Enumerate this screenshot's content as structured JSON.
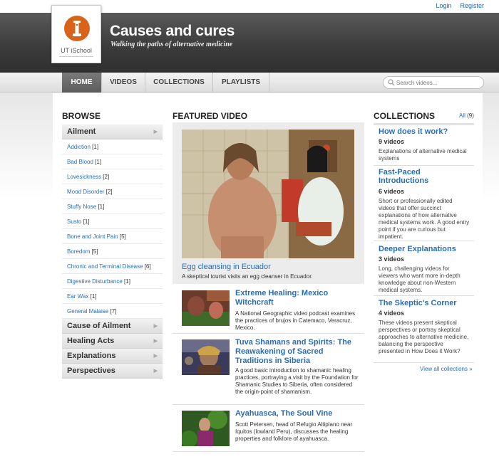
{
  "top_links": {
    "login": "Login",
    "register": "Register"
  },
  "header": {
    "logo_text": "UT iSchool",
    "title": "Causes and cures",
    "tagline": "Walking the paths of alternative medicine",
    "brand_color": "#d8641c"
  },
  "nav": {
    "items": [
      {
        "label": "HOME",
        "active": true
      },
      {
        "label": "VIDEOS",
        "active": false
      },
      {
        "label": "COLLECTIONS",
        "active": false
      },
      {
        "label": "PLAYLISTS",
        "active": false
      }
    ],
    "search_placeholder": "Search videos..."
  },
  "browse": {
    "heading": "BROWSE",
    "categories": [
      {
        "label": "Ailment",
        "expanded": true
      },
      {
        "label": "Cause of Ailment"
      },
      {
        "label": "Healing Acts"
      },
      {
        "label": "Explanations"
      },
      {
        "label": "Perspectives"
      }
    ],
    "ailments": [
      {
        "label": "Addiction",
        "count": "[1]"
      },
      {
        "label": "Bad Blood",
        "count": "[1]"
      },
      {
        "label": "Lovesickness",
        "count": "[2]"
      },
      {
        "label": "Mood Disorder",
        "count": "[2]"
      },
      {
        "label": "Stuffy Nose",
        "count": "[1]"
      },
      {
        "label": "Susto",
        "count": "[1]"
      },
      {
        "label": "Bone and Joint Pain",
        "count": "[5]"
      },
      {
        "label": "Boredom",
        "count": "[5]"
      },
      {
        "label": "Chronic and Terminal Disease",
        "count": "[6]"
      },
      {
        "label": "Digestive Disturbance",
        "count": "[1]"
      },
      {
        "label": "Ear Wax",
        "count": "[1]"
      },
      {
        "label": "General Malaise",
        "count": "[7]"
      }
    ]
  },
  "featured": {
    "heading": "FEATURED VIDEO",
    "title": "Egg cleansing in Ecuador",
    "description": "A skeptical tourist visits an egg cleanser in Ecuador.",
    "videos": [
      {
        "title": "Extreme Healing: Mexico Witchcraft",
        "description": "A National Geographic video podcast examines the practices of brujos in Catemaco, Veracruz, Mexico."
      },
      {
        "title": "Tuva Shamans and Spirits: The Reawakening of Sacred Traditions in Siberia",
        "description": "A good basic introduction to shamanic healing practices, portraying a visit by the Foundation for Shamanic Studies to Siberia, often considered the origin-point of shamanism."
      },
      {
        "title": "Ayahuasca, The Soul Vine",
        "description": "Scott Petersen, head of Refugio Altiplano near Iquitos (lowland Peru), discusses the healing properties and folklore of ayahuasca."
      }
    ]
  },
  "collections": {
    "heading": "COLLECTIONS",
    "all_label": "All",
    "all_count": "(9)",
    "items": [
      {
        "title": "How does it work?",
        "count": "9 videos",
        "description": "Explanations of alternative medical systems"
      },
      {
        "title": "Fast-Paced Introductions",
        "count": "6 videos",
        "description": "Short or professionally edited videos that offer succinct explanations of how alternative medical systems work. A good entry point if you are curious but impatient."
      },
      {
        "title": "Deeper Explanations",
        "count": "3 videos",
        "description": "Long, challenging videos for viewers who want more in-depth knowledge about non-Western medical systems."
      },
      {
        "title": "The Skeptic's Corner",
        "count": "4 videos",
        "description": "These videos present skeptical perspectives or portray skeptical approaches to alternative medicine, balancing the perspective presented in How Does it Work?"
      }
    ],
    "view_all": "View all collections »"
  }
}
